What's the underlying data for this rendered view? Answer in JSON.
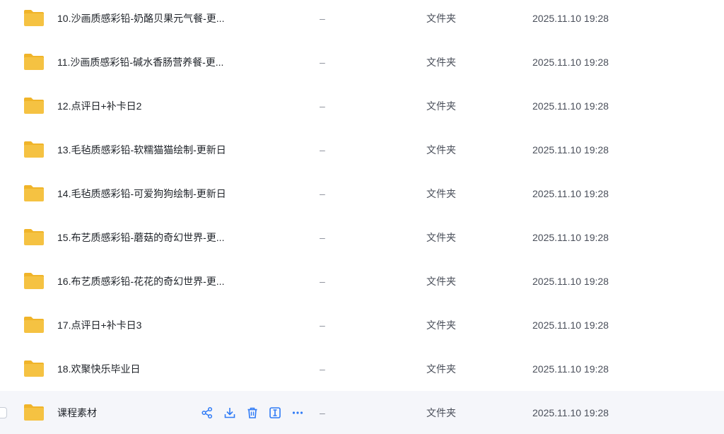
{
  "rows": [
    {
      "name": "10.沙画质感彩铅-奶酪贝果元气餐-更...",
      "size": "–",
      "type": "文件夹",
      "time": "2025.11.10 19:28"
    },
    {
      "name": "11.沙画质感彩铅-碱水香肠营养餐-更...",
      "size": "–",
      "type": "文件夹",
      "time": "2025.11.10 19:28"
    },
    {
      "name": "12.点评日+补卡日2",
      "size": "–",
      "type": "文件夹",
      "time": "2025.11.10 19:28"
    },
    {
      "name": "13.毛毡质感彩铅-软糯猫猫绘制-更新日",
      "size": "–",
      "type": "文件夹",
      "time": "2025.11.10 19:28"
    },
    {
      "name": "14.毛毡质感彩铅-可爱狗狗绘制-更新日",
      "size": "–",
      "type": "文件夹",
      "time": "2025.11.10 19:28"
    },
    {
      "name": "15.布艺质感彩铅-蘑菇的奇幻世界-更...",
      "size": "–",
      "type": "文件夹",
      "time": "2025.11.10 19:28"
    },
    {
      "name": "16.布艺质感彩铅-花花的奇幻世界-更...",
      "size": "–",
      "type": "文件夹",
      "time": "2025.11.10 19:28"
    },
    {
      "name": "17.点评日+补卡日3",
      "size": "–",
      "type": "文件夹",
      "time": "2025.11.10 19:28"
    },
    {
      "name": "18.欢聚快乐毕业日",
      "size": "–",
      "type": "文件夹",
      "time": "2025.11.10 19:28"
    },
    {
      "name": "课程素材",
      "size": "–",
      "type": "文件夹",
      "time": "2025.11.10 19:28"
    }
  ],
  "colors": {
    "folder_body": "#f5c242",
    "folder_tab": "#f0b429",
    "action_icon": "#2f7bf6",
    "hover_row": "#f5f6fa"
  },
  "hover_actions": [
    "share-icon",
    "download-icon",
    "delete-icon",
    "rename-icon",
    "more-icon"
  ]
}
